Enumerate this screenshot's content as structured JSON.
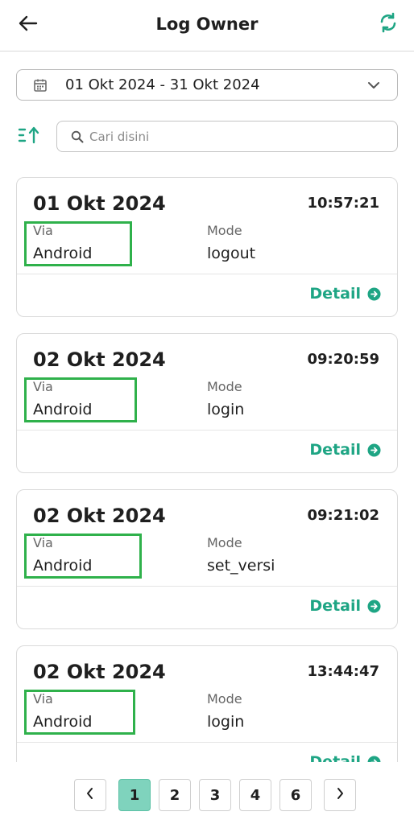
{
  "header": {
    "title": "Log Owner",
    "back_icon": "arrow-left-icon",
    "refresh_icon": "refresh-icon",
    "accent_color": "#1ea584"
  },
  "filter": {
    "date_range": "01 Okt 2024 - 31 Okt 2024",
    "calendar_icon": "calendar-icon",
    "dropdown_icon": "chevron-down-icon"
  },
  "search": {
    "placeholder": "Cari disini",
    "value": "",
    "sort_icon": "sort-ascending-icon",
    "search_icon": "search-icon"
  },
  "labels": {
    "via": "Via",
    "mode": "Mode",
    "detail": "Detail"
  },
  "logs": [
    {
      "date": "01 Okt 2024",
      "time": "10:57:21",
      "via": "Android",
      "mode": "logout"
    },
    {
      "date": "02 Okt 2024",
      "time": "09:20:59",
      "via": "Android",
      "mode": "login"
    },
    {
      "date": "02 Okt 2024",
      "time": "09:21:02",
      "via": "Android",
      "mode": "set_versi"
    },
    {
      "date": "02 Okt 2024",
      "time": "13:44:47",
      "via": "Android",
      "mode": "login"
    }
  ],
  "pagination": {
    "prev_icon": "chevron-left-icon",
    "next_icon": "chevron-right-icon",
    "pages": [
      "1",
      "2",
      "3",
      "4",
      "6"
    ],
    "current": "1",
    "active_color": "#7fd3bd"
  },
  "highlight_color": "#2fb14b"
}
